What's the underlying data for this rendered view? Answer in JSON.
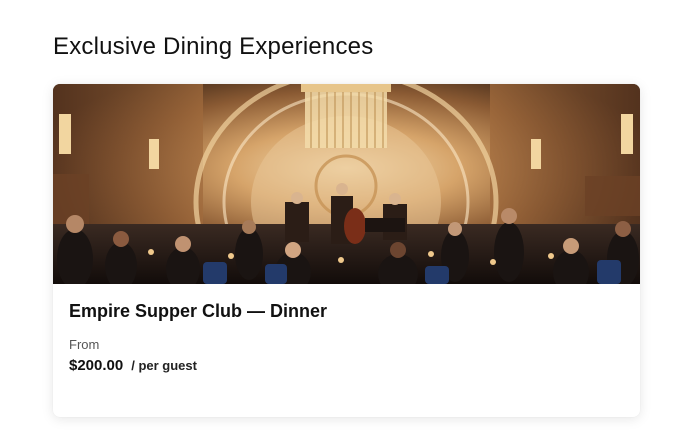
{
  "section": {
    "title": "Exclusive Dining Experiences"
  },
  "card": {
    "image_alt": "Empire Supper Club dining room with live jazz band",
    "title": "Empire Supper Club — Dinner",
    "from_label": "From",
    "price": "$200.00",
    "price_unit": "/ per guest"
  },
  "colors": {
    "text": "#111111",
    "muted": "#555555",
    "card_bg": "#ffffff"
  }
}
